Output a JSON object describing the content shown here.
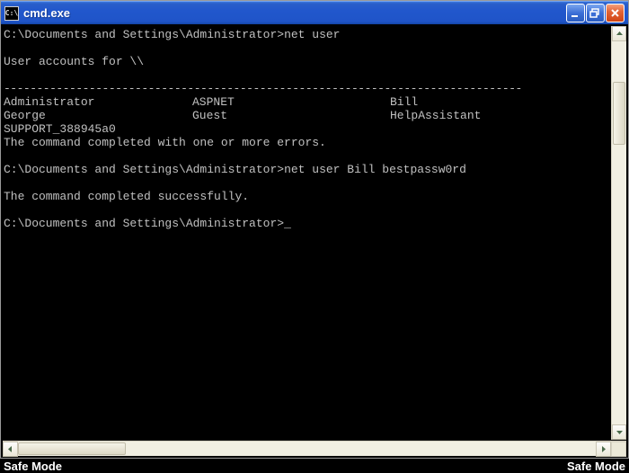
{
  "window": {
    "title": "cmd.exe",
    "icon_label": "C:\\"
  },
  "terminal": {
    "prompt_path": "C:\\Documents and Settings\\Administrator>",
    "cmd1": "net user",
    "accounts_header": "User accounts for \\\\",
    "separator": "-------------------------------------------------------------------------------",
    "users": [
      [
        "Administrator",
        "ASPNET",
        "Bill"
      ],
      [
        "George",
        "Guest",
        "HelpAssistant"
      ],
      [
        "SUPPORT_388945a0",
        "",
        ""
      ]
    ],
    "cmd1_result": "The command completed with one or more errors.",
    "cmd2": "net user Bill bestpassw0rd",
    "cmd2_result": "The command completed successfully.",
    "cursor": "_"
  },
  "desktop": {
    "safe_mode_label": "Safe Mode"
  }
}
